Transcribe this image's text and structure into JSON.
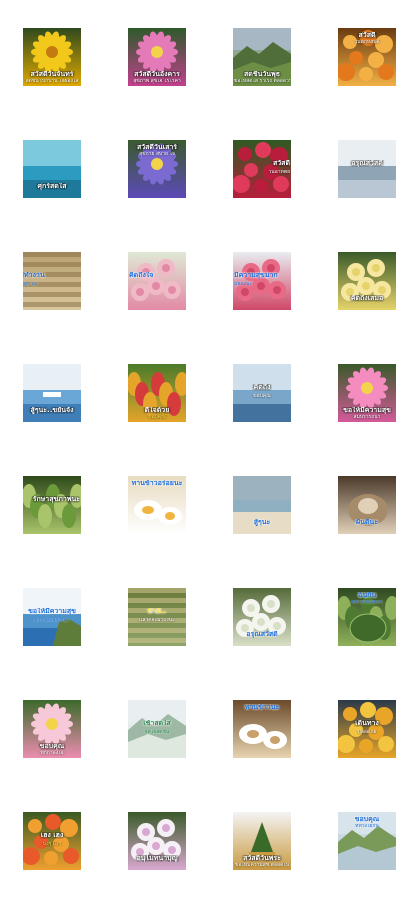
{
  "stickers": [
    {
      "id": "s01",
      "main": "สวัสดีวันจันทร์",
      "sub": "สดชื่น เบิกบาน ใจผ่องใส",
      "main_color": "#ffffff",
      "sub_color": "#ffffff",
      "cap_pos": "bottom",
      "bg": [
        "#2f4a1e",
        "#f2c81a",
        "#e0a800"
      ],
      "shape": "yellow-flower"
    },
    {
      "id": "s02",
      "main": "สวัสดีวันอังคาร",
      "sub": "สุขภาพ สุขใจ ไร้โรคา",
      "main_color": "#ffffff",
      "sub_color": "#ffffff",
      "cap_pos": "bottom",
      "bg": [
        "#2e5a2a",
        "#e47ab8",
        "#c2408e"
      ],
      "shape": "pink-flower"
    },
    {
      "id": "s03",
      "main": "สดชื่นวันพุธ",
      "sub": "ขอให้สดใส ร่าเริง ตลอดวัน",
      "main_color": "#ffffff",
      "sub_color": "#ffffff",
      "cap_pos": "bottom",
      "bg": [
        "#a7b8c4",
        "#4f6e3a",
        "#6d8f45"
      ],
      "shape": "landscape"
    },
    {
      "id": "s04",
      "main": "สวัสดี",
      "sub": "วันพฤหัสบดี",
      "main_color": "#ffffff",
      "sub_color": "#ffffff",
      "cap_pos": "top",
      "bg": [
        "#6a3b10",
        "#e3781c",
        "#f2b045"
      ],
      "shape": "orange-flowers"
    },
    {
      "id": "s05",
      "main": "ศุกร์สดใส",
      "sub": "",
      "main_color": "#ffffff",
      "sub_color": "#ffffff",
      "cap_pos": "bottom",
      "bg": [
        "#1a6b8a",
        "#2c9bc0",
        "#7cc9de"
      ],
      "shape": "sea"
    },
    {
      "id": "s06",
      "main": "สวัสดีวันเสาร์",
      "sub": "สุขกาย สบาย ใจ",
      "main_color": "#ffffff",
      "sub_color": "#ffffff",
      "cap_pos": "top",
      "bg": [
        "#3a5a2f",
        "#7b6bd1",
        "#5c4ab8"
      ],
      "shape": "purple-flower"
    },
    {
      "id": "s07",
      "main": "สวัสดี",
      "sub": "วันอาทิตย์",
      "main_color": "#ffffff",
      "sub_color": "#ffffff",
      "cap_pos": "right",
      "bg": [
        "#2f5a22",
        "#e03a5a",
        "#b81e3c"
      ],
      "shape": "red-flowers"
    },
    {
      "id": "s08",
      "main": "อรุณสวัสดิ์",
      "sub": "",
      "main_color": "#ffffff",
      "sub_color": "#ffffff",
      "cap_pos": "middle",
      "bg": [
        "#c9d6e0",
        "#8fa5b6",
        "#e8eef2"
      ],
      "shape": "misty-sea"
    },
    {
      "id": "s09",
      "main": "ทำงาน",
      "sub": "สู้ๆ นะ",
      "main_color": "#1e6fd9",
      "sub_color": "#1e6fd9",
      "cap_pos": "left",
      "bg": [
        "#b8a070",
        "#8a7148",
        "#d9c89d"
      ],
      "shape": "basket"
    },
    {
      "id": "s10",
      "main": "คิดถึงใจ",
      "sub": "",
      "main_color": "#1e6fd9",
      "sub_color": "#1e6fd9",
      "cap_pos": "left",
      "bg": [
        "#dfe9d5",
        "#f0b9c6",
        "#e28aa5"
      ],
      "shape": "roses"
    },
    {
      "id": "s11",
      "main": "มีความสุขมาก",
      "sub": "มีพลังนะ",
      "main_color": "#1e6fd9",
      "sub_color": "#1e6fd9",
      "cap_pos": "left",
      "bg": [
        "#e8edf0",
        "#e86a86",
        "#d04768"
      ],
      "shape": "pink-hydrangea"
    },
    {
      "id": "s12",
      "main": "คิดถึงเสมอ",
      "sub": "",
      "main_color": "#ffffff",
      "sub_color": "#ffffff",
      "cap_pos": "bottom",
      "bg": [
        "#3b5a2a",
        "#f5e7a0",
        "#e6d36a"
      ],
      "shape": "white-rose"
    },
    {
      "id": "s13",
      "main": "สู้ๆนะ..ขยันจัง",
      "sub": "",
      "main_color": "#ffffff",
      "sub_color": "#ffffff",
      "cap_pos": "bottom",
      "bg": [
        "#2e6da8",
        "#6aa6d6",
        "#e9f0f5"
      ],
      "shape": "boat"
    },
    {
      "id": "s14",
      "main": "ดีใจด้วย",
      "sub": "ขอบคุณ",
      "main_color": "#ffffff",
      "sub_color": "#ffde3b",
      "cap_pos": "bottom",
      "bg": [
        "#4b7a2a",
        "#d63b3b",
        "#e4a52a"
      ],
      "shape": "garden"
    },
    {
      "id": "s15",
      "main": "คิดถึง",
      "sub": "ขอบคุณ",
      "main_color": "#ffffff",
      "sub_color": "#ffffff",
      "cap_pos": "middle",
      "bg": [
        "#2c5d8c",
        "#79a6c9",
        "#cfe0ec"
      ],
      "shape": "sky-sea"
    },
    {
      "id": "s16",
      "main": "ขอให้มีความสุข",
      "sub": "สมปรารถนา",
      "main_color": "#ffffff",
      "sub_color": "#ffffff",
      "cap_pos": "bottom",
      "bg": [
        "#3a5a2a",
        "#f48cc0",
        "#d45a9a"
      ],
      "shape": "pink-dahlia"
    },
    {
      "id": "s17",
      "main": "รักษาสุขภาพนะ",
      "sub": "",
      "main_color": "#ffffff",
      "sub_color": "#ffffff",
      "cap_pos": "right",
      "bg": [
        "#2f4a1a",
        "#6b9a3a",
        "#a9c46a"
      ],
      "shape": "green-leaves"
    },
    {
      "id": "s18",
      "main": "ทานข้าวอร่อยนะ",
      "sub": "",
      "main_color": "#1e6fd9",
      "sub_color": "#1e6fd9",
      "cap_pos": "top",
      "bg": [
        "#e8dcc0",
        "#f0b440",
        "#ffffff"
      ],
      "shape": "food"
    },
    {
      "id": "s19",
      "main": "สู้ๆนะ",
      "sub": "",
      "main_color": "#1e6fd9",
      "sub_color": "#1e6fd9",
      "cap_pos": "bottom",
      "bg": [
        "#cfd9df",
        "#e7ddc6",
        "#9cb2bf"
      ],
      "shape": "beach"
    },
    {
      "id": "s20",
      "main": "ฝันดีนะ",
      "sub": "",
      "main_color": "#1e6fd9",
      "sub_color": "#1e6fd9",
      "cap_pos": "bottom",
      "bg": [
        "#4b3a2a",
        "#a68b6a",
        "#e0d0b8"
      ],
      "shape": "cat"
    },
    {
      "id": "s21",
      "main": "ขอให้มีความสุข",
      "sub": "อากาศดีจริงๆนะ",
      "main_color": "#1e6fd9",
      "sub_color": "#1e6fd9",
      "cap_pos": "middle",
      "bg": [
        "#1e5fa8",
        "#4e93c9",
        "#f0f5f9"
      ],
      "shape": "coast"
    },
    {
      "id": "s22",
      "main": "ทำดี..",
      "sub": "แล้วดีจะมาถึงนะ",
      "main_color": "#ffde3b",
      "sub_color": "#ffffff",
      "cap_pos": "middle",
      "bg": [
        "#6a7a3a",
        "#d4c690",
        "#8fa56a"
      ],
      "shape": "field"
    },
    {
      "id": "s23",
      "main": "อรุณสวัสดิ์",
      "sub": "",
      "main_color": "#1e6fd9",
      "sub_color": "#1e6fd9",
      "cap_pos": "bottom",
      "bg": [
        "#556b3a",
        "#f5f5f0",
        "#d9e0c8"
      ],
      "shape": "lily"
    },
    {
      "id": "s24",
      "main": "ฉันกิน",
      "sub": "ผลไม้ได้เรื่อยๆ",
      "main_color": "#1e6fd9",
      "sub_color": "#1e6fd9",
      "cap_pos": "top",
      "bg": [
        "#2f4a22",
        "#4f7a32",
        "#8fb05a"
      ],
      "shape": "melon"
    },
    {
      "id": "s25",
      "main": "ขอบคุณ",
      "sub": "ทุกกำลังใจ",
      "main_color": "#ffffff",
      "sub_color": "#ffffff",
      "cap_pos": "bottom",
      "bg": [
        "#3b6a2a",
        "#f7c8d8",
        "#ec8db0"
      ],
      "shape": "gerbera"
    },
    {
      "id": "s26",
      "main": "เช้าสดใส",
      "sub": "จิตใจสดชื่น",
      "main_color": "#2e8b57",
      "sub_color": "#2e8b57",
      "cap_pos": "middle",
      "bg": [
        "#e9eef0",
        "#9db8a4",
        "#dfe8df"
      ],
      "shape": "misty-hills"
    },
    {
      "id": "s27",
      "main": "ทานข้าวนะ",
      "sub": "",
      "main_color": "#1e6fd9",
      "sub_color": "#1e6fd9",
      "cap_pos": "top",
      "bg": [
        "#6a4a2a",
        "#c9a06a",
        "#e8d4b0"
      ],
      "shape": "dishes"
    },
    {
      "id": "s28",
      "main": "เดินทาง",
      "sub": "ปลอดภัย",
      "main_color": "#ffffff",
      "sub_color": "#ffffff",
      "cap_pos": "middle",
      "bg": [
        "#2b3a4a",
        "#f2c440",
        "#e8a528"
      ],
      "shape": "marigolds"
    },
    {
      "id": "s29",
      "main": "เฮง เฮง",
      "sub": "ปังๆ ปังๆ",
      "main_color": "#ffffff",
      "sub_color": "#ffde3b",
      "cap_pos": "middle",
      "bg": [
        "#3a5a22",
        "#e85a2a",
        "#f0a030"
      ],
      "shape": "tulips"
    },
    {
      "id": "s30",
      "main": "อนุโมทนาบุญ",
      "sub": "",
      "main_color": "#ffffff",
      "sub_color": "#ffffff",
      "cap_pos": "bottom",
      "bg": [
        "#3a5a2a",
        "#f5f0f5",
        "#d9a8d0"
      ],
      "shape": "orchids"
    },
    {
      "id": "s31",
      "main": "สวัสดีวันพระ",
      "sub": "ขอให้มีความสุข ตลอดไป",
      "main_color": "#ffffff",
      "sub_color": "#ffffff",
      "cap_pos": "bottom",
      "bg": [
        "#f4f4f4",
        "#3a6a2a",
        "#c99a40"
      ],
      "shape": "offering"
    },
    {
      "id": "s32",
      "main": "ขอบคุณ",
      "sub": "ที่ห่วงใยกัน",
      "main_color": "#1e6fd9",
      "sub_color": "#1e6fd9",
      "cap_pos": "top",
      "bg": [
        "#d8e4ec",
        "#7a9a5a",
        "#b4c8d4"
      ],
      "shape": "valley"
    }
  ]
}
